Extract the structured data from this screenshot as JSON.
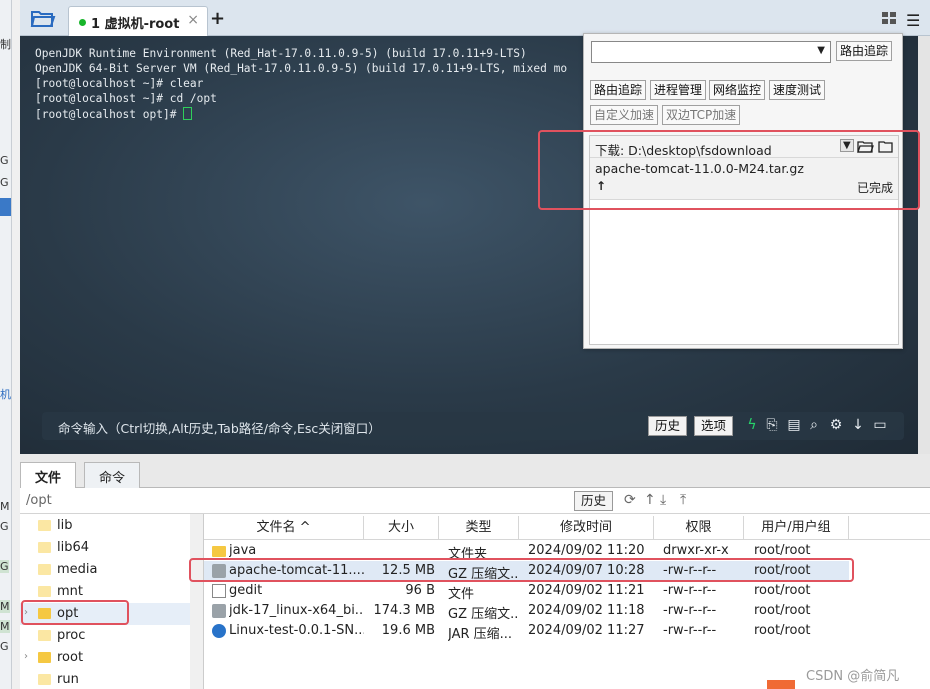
{
  "tabs": [
    {
      "label": "1 虚拟机-root",
      "active": true
    }
  ],
  "terminal": {
    "lines": [
      "OpenJDK Runtime Environment (Red_Hat-17.0.11.0.9-5) (build 17.0.11+9-LTS)",
      "OpenJDK 64-Bit Server VM (Red_Hat-17.0.11.0.9-5) (build 17.0.11+9-LTS, mixed mo",
      "[root@localhost ~]# clear",
      "[root@localhost ~]# cd /opt",
      "[root@localhost opt]# "
    ],
    "cursor_color": "#2fcf5a"
  },
  "cmdbar": {
    "prompt": "命令输入（Ctrl切换,Alt历史,Tab路径/命令,Esc关闭窗口）",
    "history_label": "历史",
    "options_label": "选项"
  },
  "popup": {
    "trace_button": "路由追踪",
    "tools": [
      "路由追踪",
      "进程管理",
      "网络监控",
      "速度测试"
    ],
    "tools2": [
      "自定义加速",
      "双边TCP加速"
    ],
    "download_label": "下载: D:\\desktop\\fsdownload",
    "download_file": "apache-tomcat-11.0.0-M24.tar.gz",
    "download_status": "已完成",
    "highlight_color": "#e0525e"
  },
  "lower": {
    "tabs": [
      "文件",
      "命令"
    ],
    "path": "/opt",
    "history_label": "历史",
    "tree": [
      {
        "name": "lib",
        "arrow": false
      },
      {
        "name": "lib64",
        "arrow": false
      },
      {
        "name": "media",
        "arrow": false
      },
      {
        "name": "mnt",
        "arrow": false
      },
      {
        "name": "opt",
        "arrow": true
      },
      {
        "name": "proc",
        "arrow": false
      },
      {
        "name": "root",
        "arrow": true
      },
      {
        "name": "run",
        "arrow": false
      }
    ],
    "columns": [
      "文件名 ^",
      "大小",
      "类型",
      "修改时间",
      "权限",
      "用户/用户组"
    ],
    "files": [
      {
        "name": "java",
        "size": "",
        "type": "文件夹",
        "mtime": "2024/09/02 11:20",
        "perm": "drwxr-xr-x",
        "owner": "root/root",
        "icon": "folder"
      },
      {
        "name": "apache-tomcat-11....",
        "size": "12.5 MB",
        "type": "GZ 压缩文...",
        "mtime": "2024/09/07 10:28",
        "perm": "-rw-r--r--",
        "owner": "root/root",
        "icon": "gz"
      },
      {
        "name": "gedit",
        "size": "96 B",
        "type": "文件",
        "mtime": "2024/09/02 11:21",
        "perm": "-rw-r--r--",
        "owner": "root/root",
        "icon": "file"
      },
      {
        "name": "jdk-17_linux-x64_bi...",
        "size": "174.3 MB",
        "type": "GZ 压缩文...",
        "mtime": "2024/09/02 11:18",
        "perm": "-rw-r--r--",
        "owner": "root/root",
        "icon": "gz"
      },
      {
        "name": "Linux-test-0.0.1-SN...",
        "size": "19.6 MB",
        "type": "JAR 压缩...",
        "mtime": "2024/09/02 11:27",
        "perm": "-rw-r--r--",
        "owner": "root/root",
        "icon": "jar"
      }
    ]
  },
  "left_strip": [
    "制",
    "G",
    "G",
    "机",
    "M",
    "G",
    "G",
    "M",
    "M",
    "G"
  ],
  "watermark": "CSDN @俞简凡"
}
